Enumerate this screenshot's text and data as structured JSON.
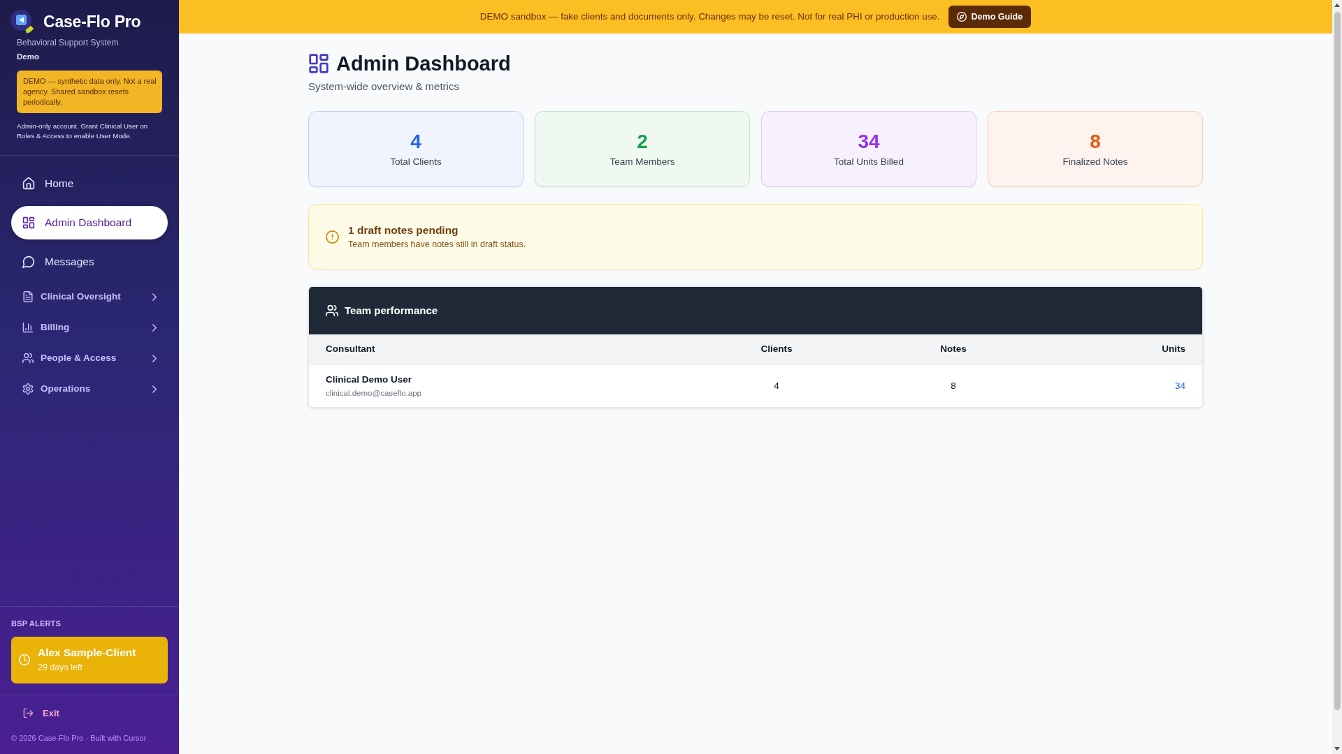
{
  "sidebar": {
    "brand": {
      "name": "Case-Flo Pro",
      "tagline": "Behavioral Support System",
      "edition": "Demo"
    },
    "demo_notice": "DEMO — synthetic data only. Not a real agency. Shared sandbox resets periodically.",
    "account_note": "Admin-only account. Grant Clinical User on Roles & Access to enable User Mode.",
    "nav": [
      {
        "label": "Home",
        "selected": false
      },
      {
        "label": "Admin Dashboard",
        "selected": true
      },
      {
        "label": "Messages",
        "selected": false
      }
    ],
    "menu_groups": [
      {
        "label": "Clinical Oversight",
        "expanded": false
      },
      {
        "label": "Billing",
        "expanded": false
      },
      {
        "label": "People & Access",
        "expanded": false
      },
      {
        "label": "Operations",
        "expanded": false
      }
    ],
    "bsp_alerts": {
      "title": "BSP ALERTS",
      "items": [
        {
          "client": "Alex Sample-Client",
          "remaining": "29 days left"
        }
      ]
    },
    "exit": {
      "label": "Exit"
    },
    "footer": "© 2026 Case-Flo Pro · Built with Cursor"
  },
  "banner": {
    "text": "DEMO sandbox — fake clients and documents only. Changes may be reset. Not for real PHI or production use.",
    "button": "Demo Guide"
  },
  "page_header": {
    "title": "Admin Dashboard",
    "subtitle": "System-wide overview & metrics"
  },
  "stats": [
    {
      "value": "4",
      "label": "Total Clients",
      "color": "#2563eb"
    },
    {
      "value": "2",
      "label": "Team Members",
      "color": "#16a34a"
    },
    {
      "value": "34",
      "label": "Total Units Billed",
      "color": "#9333ea"
    },
    {
      "value": "8",
      "label": "Finalized Notes",
      "color": "#ea580c"
    }
  ],
  "alert": {
    "title": "1 draft notes pending",
    "text": "Team members have notes still in draft status."
  },
  "team_performance": {
    "title": "Team performance",
    "columns": [
      "Consultant",
      "Clients",
      "Notes",
      "Units"
    ],
    "rows": [
      {
        "consultant": "Clinical Demo User",
        "email": "clinical.demo@caseflo.app",
        "clients": "4",
        "notes": "8",
        "units": "34"
      }
    ]
  }
}
